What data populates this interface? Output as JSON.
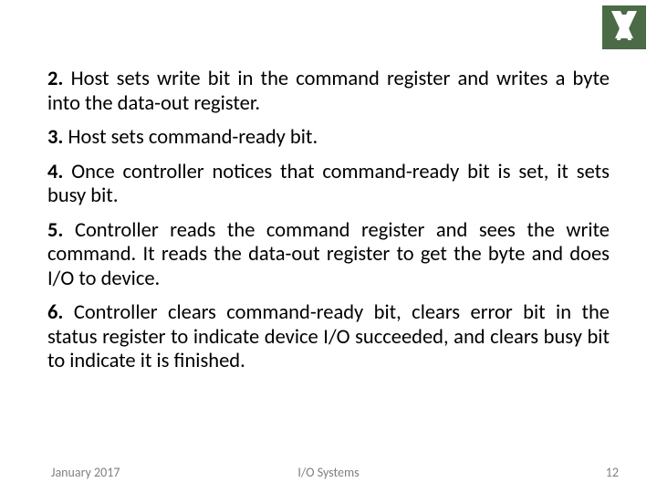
{
  "logo": {
    "name": "university-logo"
  },
  "items": [
    {
      "num": "2.",
      "text": " Host sets write bit in the command register and writes a byte into the data-out register."
    },
    {
      "num": "3.",
      "text": " Host sets command-ready bit."
    },
    {
      "num": "4.",
      "text": " Once controller notices that command-ready bit is set, it sets busy bit."
    },
    {
      "num": "5.",
      "text": " Controller reads the command register and sees the write command. It reads the data-out register to get the byte and does I/O to device."
    },
    {
      "num": "6.",
      "text": " Controller clears command-ready bit, clears error bit in the status register to indicate device I/O succeeded, and clears busy bit to indicate it is finished."
    }
  ],
  "footer": {
    "date": "January 2017",
    "title": "I/O Systems",
    "page": "12"
  }
}
